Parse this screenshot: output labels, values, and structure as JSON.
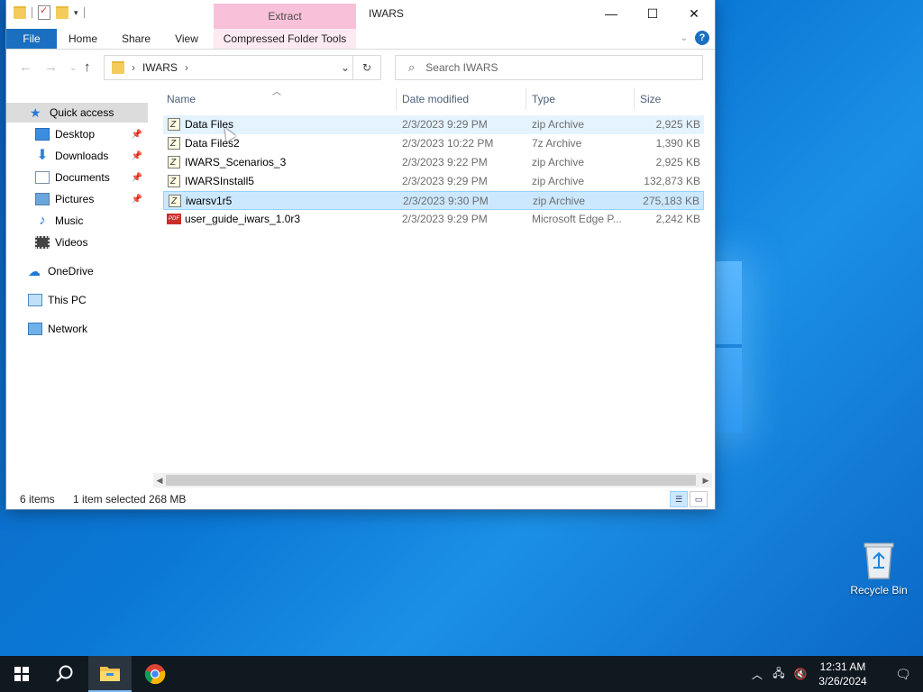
{
  "window": {
    "title": "IWARS",
    "context_tab": "Extract",
    "tabs": [
      "File",
      "Home",
      "Share",
      "View",
      "Compressed Folder Tools"
    ],
    "caption": {
      "minimize": "—",
      "maximize": "☐",
      "close": "✕"
    }
  },
  "address": {
    "path": "IWARS",
    "separator": "›"
  },
  "search": {
    "placeholder": "Search IWARS"
  },
  "nav": {
    "items": [
      {
        "label": "Quick access",
        "icon": "star-icon"
      },
      {
        "label": "Desktop",
        "icon": "desktop-icon",
        "pinned": true
      },
      {
        "label": "Downloads",
        "icon": "download-icon",
        "pinned": true
      },
      {
        "label": "Documents",
        "icon": "documents-icon",
        "pinned": true
      },
      {
        "label": "Pictures",
        "icon": "pictures-icon",
        "pinned": true
      },
      {
        "label": "Music",
        "icon": "music-icon"
      },
      {
        "label": "Videos",
        "icon": "videos-icon"
      },
      {
        "label": "OneDrive",
        "icon": "cloud-icon"
      },
      {
        "label": "This PC",
        "icon": "computer-icon"
      },
      {
        "label": "Network",
        "icon": "network-icon"
      }
    ]
  },
  "columns": [
    "Name",
    "Date modified",
    "Type",
    "Size"
  ],
  "files": [
    {
      "name": "Data Files",
      "date": "2/3/2023 9:29 PM",
      "type": "zip Archive",
      "size": "2,925 KB"
    },
    {
      "name": "Data Files2",
      "date": "2/3/2023 10:22 PM",
      "type": "7z Archive",
      "size": "1,390 KB"
    },
    {
      "name": "IWARS_Scenarios_3",
      "date": "2/3/2023 9:22 PM",
      "type": "zip Archive",
      "size": "2,925 KB"
    },
    {
      "name": "IWARSInstall5",
      "date": "2/3/2023 9:29 PM",
      "type": "zip Archive",
      "size": "132,873 KB"
    },
    {
      "name": "iwarsv1r5",
      "date": "2/3/2023 9:30 PM",
      "type": "zip Archive",
      "size": "275,183 KB"
    },
    {
      "name": "user_guide_iwars_1.0r3",
      "date": "2/3/2023 9:29 PM",
      "type": "Microsoft Edge P...",
      "size": "2,242 KB"
    }
  ],
  "status": {
    "count": "6 items",
    "selected": "1 item selected",
    "size": "268 MB"
  },
  "desktop": {
    "recycle_bin": "Recycle Bin"
  },
  "taskbar": {
    "time": "12:31 AM",
    "date": "3/26/2024"
  },
  "colors": {
    "accent": "#1a6fc1",
    "extract_tab": "#f9c1d9",
    "selection": "#cce8ff"
  }
}
